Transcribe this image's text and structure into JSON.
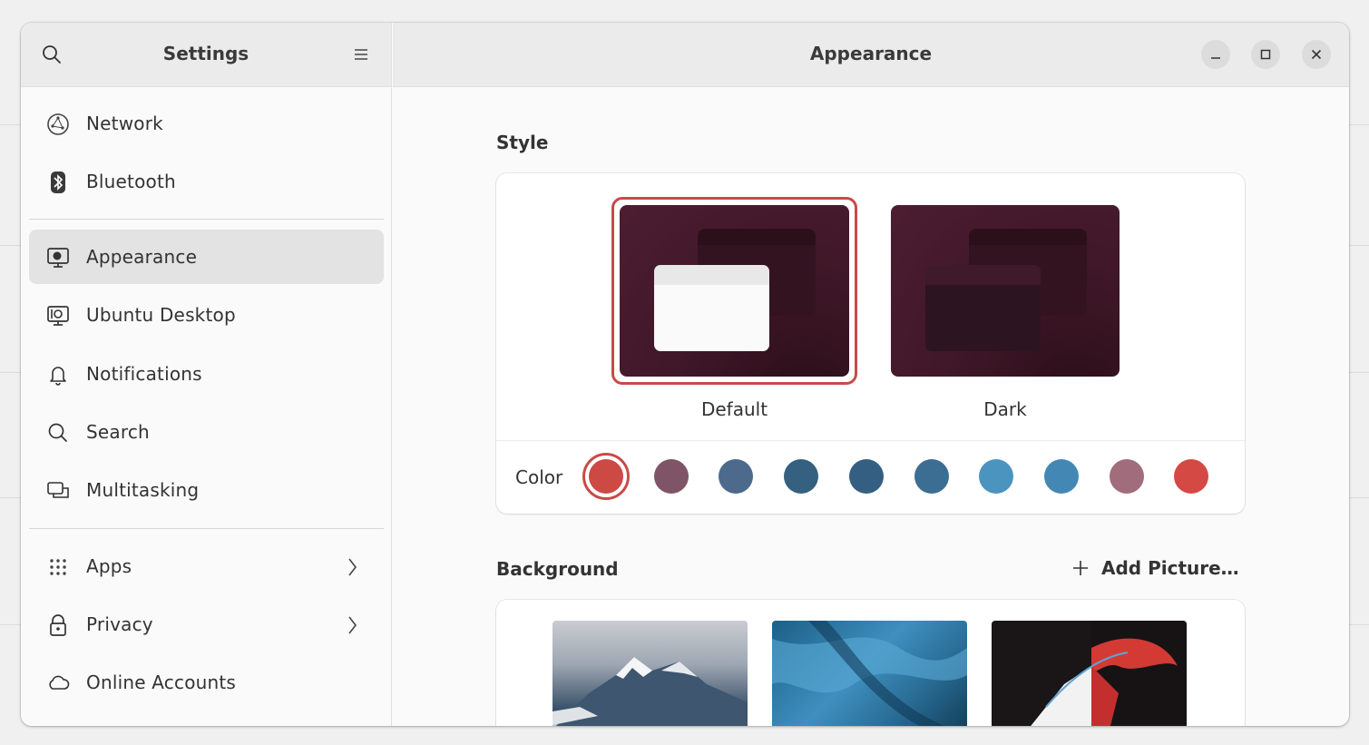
{
  "sidebar": {
    "title": "Settings",
    "items": [
      {
        "label": "Network",
        "icon": "network-icon"
      },
      {
        "label": "Bluetooth",
        "icon": "bluetooth-icon"
      },
      {
        "label": "Appearance",
        "icon": "appearance-icon",
        "active": true
      },
      {
        "label": "Ubuntu Desktop",
        "icon": "ubuntu-desktop-icon"
      },
      {
        "label": "Notifications",
        "icon": "bell-icon"
      },
      {
        "label": "Search",
        "icon": "search-icon"
      },
      {
        "label": "Multitasking",
        "icon": "multitasking-icon"
      },
      {
        "label": "Apps",
        "icon": "apps-grid-icon",
        "has_chevron": true
      },
      {
        "label": "Privacy",
        "icon": "lock-icon",
        "has_chevron": true
      },
      {
        "label": "Online Accounts",
        "icon": "cloud-icon"
      }
    ]
  },
  "header": {
    "title": "Appearance"
  },
  "style_section": {
    "title": "Style",
    "themes": [
      {
        "label": "Default",
        "selected": true
      },
      {
        "label": "Dark",
        "selected": false
      }
    ],
    "color_label": "Color",
    "colors": [
      "#cc4944",
      "#7e5466",
      "#4d6a8c",
      "#35607f",
      "#355f82",
      "#3b6e92",
      "#4b94c0",
      "#4388b5",
      "#a16c7c",
      "#d44944"
    ],
    "selected_color_index": 0
  },
  "background_section": {
    "title": "Background",
    "add_picture_label": "Add Picture…"
  },
  "accent_color": "#c94a46"
}
